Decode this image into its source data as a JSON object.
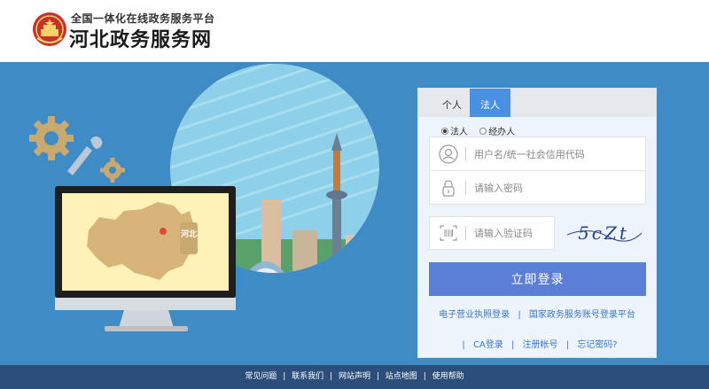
{
  "header": {
    "subtitle": "全国一体化在线政务服务平台",
    "title": "河北政务服务网"
  },
  "illustration": {
    "map_region_label": "河北"
  },
  "login": {
    "tabs": [
      {
        "label": "个人",
        "active": false
      },
      {
        "label": "法人",
        "active": true
      }
    ],
    "radios": [
      {
        "label": "法人",
        "checked": true
      },
      {
        "label": "经办人",
        "checked": false
      }
    ],
    "username_placeholder": "用户名/统一社会信用代码",
    "password_placeholder": "请输入密码",
    "captcha_placeholder": "请输入验证码",
    "captcha_text": "5cZt",
    "submit_label": "立即登录",
    "links_row1": [
      "电子营业执照登录",
      "国家政务服务账号登录平台"
    ],
    "links_row2": [
      "CA登录",
      "注册帐号",
      "忘记密码?"
    ]
  },
  "footer": {
    "links": [
      "常见问题",
      "联系我们",
      "网站声明",
      "站点地图",
      "使用帮助"
    ]
  },
  "colors": {
    "banner_bg": "#3f8bc5",
    "tab_active": "#4a90e2",
    "login_button": "#5b7fd6",
    "footer_bg": "#2b4e7a",
    "link": "#3b77c0"
  }
}
